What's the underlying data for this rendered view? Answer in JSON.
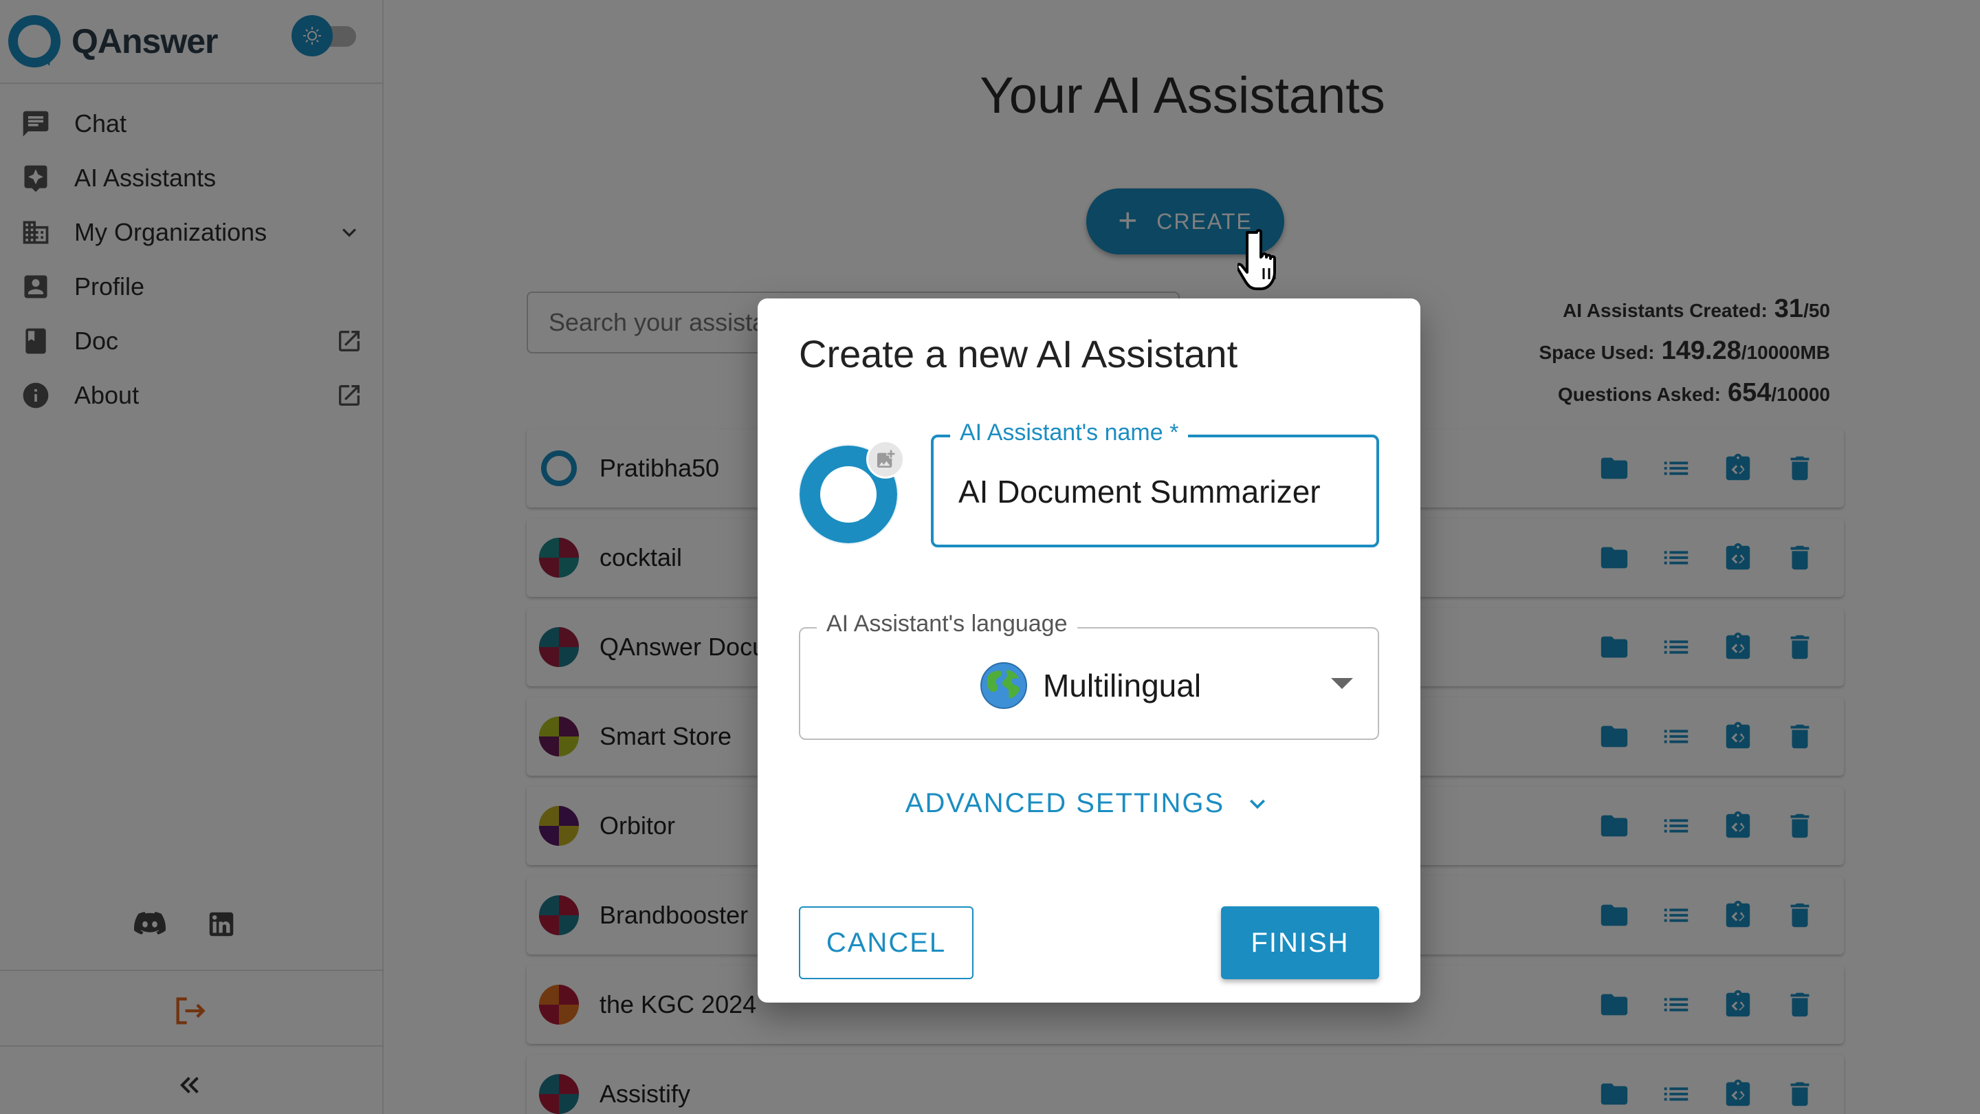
{
  "app": {
    "name": "QAnswer",
    "accent": "#1b8dc1"
  },
  "sidebar": {
    "theme_toggle_icon": "sun-icon",
    "items": [
      {
        "label": "Chat",
        "icon": "chat-icon"
      },
      {
        "label": "AI Assistants",
        "icon": "ai-assistant-icon"
      },
      {
        "label": "My Organizations",
        "icon": "organization-icon",
        "trailing": "chevron-down-icon"
      },
      {
        "label": "Profile",
        "icon": "profile-icon"
      },
      {
        "label": "Doc",
        "icon": "book-icon",
        "trailing": "open-in-new-icon"
      },
      {
        "label": "About",
        "icon": "info-icon",
        "trailing": "open-in-new-icon"
      }
    ],
    "social": [
      "discord-icon",
      "linkedin-icon"
    ],
    "logout_icon": "logout-icon",
    "collapse_icon": "double-chevron-left-icon"
  },
  "main": {
    "title": "Your AI Assistants",
    "create_label": "CREATE",
    "search_placeholder": "Search your assistants",
    "stats": {
      "created_label": "AI Assistants Created:",
      "created_value": "31",
      "created_max": "/50",
      "space_label": "Space Used:",
      "space_value": "149.28",
      "space_max": "/10000MB",
      "questions_label": "Questions Asked:",
      "questions_value": "654",
      "questions_max": "/10000"
    },
    "assistants": [
      {
        "name": "Pratibha50",
        "colors": [
          "#1b8dc1",
          "#ffffff"
        ],
        "logo": true
      },
      {
        "name": "cocktail",
        "colors": [
          "#1e8a8a",
          "#a02040"
        ]
      },
      {
        "name": "QAnswer Document",
        "colors": [
          "#1e7a8a",
          "#a02040"
        ]
      },
      {
        "name": "Smart Store",
        "colors": [
          "#b0c020",
          "#6a1a5a"
        ]
      },
      {
        "name": "Orbitor",
        "colors": [
          "#c0b020",
          "#5a1a6a"
        ]
      },
      {
        "name": "Brandbooster",
        "colors": [
          "#1e7a8a",
          "#b01a3a"
        ]
      },
      {
        "name": "the KGC 2024",
        "colors": [
          "#e07020",
          "#b01a3a"
        ]
      },
      {
        "name": "Assistify",
        "colors": [
          "#1e7a8a",
          "#b01a3a"
        ]
      }
    ],
    "row_actions": [
      "folder-icon",
      "list-icon",
      "code-clipboard-icon",
      "delete-icon"
    ]
  },
  "dialog": {
    "title": "Create a new AI Assistant",
    "name_label": "AI Assistant's name *",
    "name_value": "AI Document Summarizer",
    "language_label": "AI Assistant's language",
    "language_value": "Multilingual",
    "advanced_label": "ADVANCED SETTINGS",
    "cancel_label": "CANCEL",
    "finish_label": "FINISH"
  }
}
